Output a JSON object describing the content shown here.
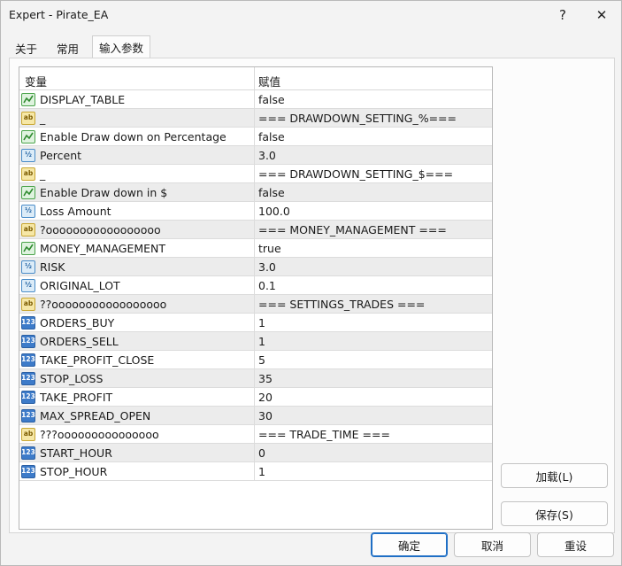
{
  "window": {
    "title": "Expert - Pirate_EA",
    "help_glyph": "?",
    "close_glyph": "✕"
  },
  "tabs": [
    {
      "label": "关于",
      "active": false
    },
    {
      "label": "常用",
      "active": false
    },
    {
      "label": "输入参数",
      "active": true
    }
  ],
  "table": {
    "headers": {
      "variable": "变量",
      "value": "赋值"
    },
    "rows": [
      {
        "type": "bool",
        "icon_text": "",
        "variable": "DISPLAY_TABLE",
        "value": "false"
      },
      {
        "type": "str",
        "icon_text": "ab",
        "variable": "_",
        "value": "=== DRAWDOWN_SETTING_%==="
      },
      {
        "type": "bool",
        "icon_text": "",
        "variable": "Enable Draw down on Percentage",
        "value": "false"
      },
      {
        "type": "dbl",
        "icon_text": "½",
        "variable": "Percent",
        "value": "3.0"
      },
      {
        "type": "str",
        "icon_text": "ab",
        "variable": "_",
        "value": "=== DRAWDOWN_SETTING_$==="
      },
      {
        "type": "bool",
        "icon_text": "",
        "variable": "Enable Draw down in $",
        "value": "false"
      },
      {
        "type": "dbl",
        "icon_text": "½",
        "variable": "Loss Amount",
        "value": "100.0"
      },
      {
        "type": "str",
        "icon_text": "ab",
        "variable": "?ooooooooooooooooo",
        "value": "=== MONEY_MANAGEMENT ==="
      },
      {
        "type": "bool",
        "icon_text": "",
        "variable": "MONEY_MANAGEMENT",
        "value": "true"
      },
      {
        "type": "dbl",
        "icon_text": "½",
        "variable": "RISK",
        "value": "3.0"
      },
      {
        "type": "dbl",
        "icon_text": "½",
        "variable": "ORIGINAL_LOT",
        "value": "0.1"
      },
      {
        "type": "str",
        "icon_text": "ab",
        "variable": "??ooooooooooooooooo",
        "value": "=== SETTINGS_TRADES ==="
      },
      {
        "type": "int",
        "icon_text": "123",
        "variable": "ORDERS_BUY",
        "value": "1"
      },
      {
        "type": "int",
        "icon_text": "123",
        "variable": "ORDERS_SELL",
        "value": "1"
      },
      {
        "type": "int",
        "icon_text": "123",
        "variable": "TAKE_PROFIT_CLOSE",
        "value": "5"
      },
      {
        "type": "int",
        "icon_text": "123",
        "variable": "STOP_LOSS",
        "value": "35"
      },
      {
        "type": "int",
        "icon_text": "123",
        "variable": "TAKE_PROFIT",
        "value": "20"
      },
      {
        "type": "int",
        "icon_text": "123",
        "variable": "MAX_SPREAD_OPEN",
        "value": "30"
      },
      {
        "type": "str",
        "icon_text": "ab",
        "variable": "???ooooooooooooooo",
        "value": "=== TRADE_TIME ==="
      },
      {
        "type": "int",
        "icon_text": "123",
        "variable": "START_HOUR",
        "value": "0"
      },
      {
        "type": "int",
        "icon_text": "123",
        "variable": "STOP_HOUR",
        "value": "1"
      }
    ]
  },
  "side_buttons": {
    "load": "加载(L)",
    "save": "保存(S)"
  },
  "footer_buttons": {
    "ok": "确定",
    "cancel": "取消",
    "reset": "重设"
  }
}
